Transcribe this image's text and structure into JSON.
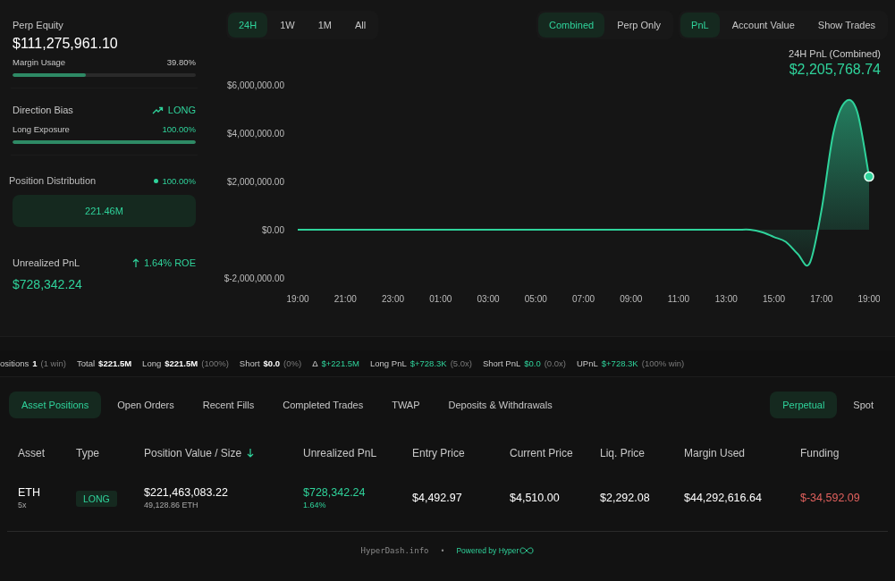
{
  "left_panel": {
    "perp_equity": {
      "label": "Perp Equity",
      "value": "$111,275,961.10"
    },
    "margin_usage": {
      "label": "Margin Usage",
      "reading": "39.80%",
      "level": 0.398
    },
    "direction_bias": {
      "label": "Direction Bias",
      "value": "LONG"
    },
    "long_exposure": {
      "label": "Long Exposure",
      "reading": "100.00%",
      "level": 1.0
    },
    "position_distribution": {
      "label": "Position Distribution",
      "reading": "100.00%",
      "bar_value": "221.46M"
    },
    "unrealized_pnl": {
      "label": "Unrealized PnL",
      "roe": "1.64% ROE",
      "value": "$728,342.24"
    }
  },
  "range_tabs": [
    {
      "label": "24H",
      "selected": true
    },
    {
      "label": "1W",
      "selected": false
    },
    {
      "label": "1M",
      "selected": false
    },
    {
      "label": "All",
      "selected": false
    }
  ],
  "mode_tabs": [
    {
      "label": "Combined",
      "selected": true
    },
    {
      "label": "Perp Only",
      "selected": false
    }
  ],
  "metric_tabs": [
    {
      "label": "PnL",
      "selected": true
    },
    {
      "label": "Account Value",
      "selected": false
    },
    {
      "label": "Show Trades",
      "selected": false
    }
  ],
  "chart_summary": {
    "label": "24H PnL (Combined)",
    "value": "$2,205,768.74"
  },
  "chart_data": {
    "type": "area",
    "categories": [
      "19:00",
      null,
      null,
      null,
      "21:00",
      null,
      null,
      null,
      "23:00",
      null,
      null,
      null,
      "01:00",
      null,
      null,
      null,
      "03:00",
      null,
      null,
      null,
      "05:00",
      null,
      null,
      null,
      "07:00",
      null,
      null,
      null,
      "09:00",
      null,
      null,
      null,
      "11:00",
      null,
      null,
      null,
      "13:00",
      null,
      null,
      null,
      "15:00",
      null,
      null,
      null,
      "17:00",
      null,
      null,
      null,
      "19:00"
    ],
    "series": [
      {
        "color": "#2fd39b",
        "values": [
          0,
          0,
          0,
          0,
          0,
          0,
          0,
          0,
          0,
          0,
          0,
          0,
          0,
          0,
          0,
          0,
          0,
          0,
          0,
          0,
          0,
          0,
          0,
          0,
          0,
          0,
          0,
          0,
          0,
          0,
          0,
          0,
          0,
          0,
          0,
          0,
          0,
          0,
          0,
          -100000,
          -300000,
          -500000,
          -1000000,
          -1400000,
          800000,
          4000000,
          5300000,
          4900000,
          2200000
        ]
      }
    ],
    "ylim": [
      -2000000,
      6000000
    ],
    "yticks": [
      {
        "value": 6000000,
        "label": "$6,000,000.00"
      },
      {
        "value": 4000000,
        "label": "$4,000,000.00"
      },
      {
        "value": 2000000,
        "label": "$2,000,000.00"
      },
      {
        "value": 0,
        "label": "$0.00"
      },
      {
        "value": -2000000,
        "label": "$-2,000,000.00"
      }
    ]
  },
  "stats": [
    {
      "label": "ositions",
      "value": "1",
      "note": "(1 win)",
      "kind": "plain"
    },
    {
      "label": "Total",
      "value": "$221.5M",
      "kind": "plain"
    },
    {
      "label": "Long",
      "value": "$221.5M",
      "note": "(100%)",
      "kind": "plain"
    },
    {
      "label": "Short",
      "value": "$0.0",
      "note": "(0%)",
      "kind": "plain"
    },
    {
      "label": "Δ",
      "value": "$+221.5M",
      "kind": "gain"
    },
    {
      "label": "Long PnL",
      "value": "$+728.3K",
      "note": "(5.0x)",
      "kind": "gain"
    },
    {
      "label": "Short PnL",
      "value": "$0.0",
      "note": "(0.0x)",
      "kind": "gain"
    },
    {
      "label": "UPnL",
      "value": "$+728.3K",
      "note": "(100% win)",
      "kind": "gain"
    }
  ],
  "section_tabs": [
    {
      "label": "Asset Positions",
      "selected": true
    },
    {
      "label": "Open Orders",
      "selected": false
    },
    {
      "label": "Recent Fills",
      "selected": false
    },
    {
      "label": "Completed Trades",
      "selected": false
    },
    {
      "label": "TWAP",
      "selected": false
    },
    {
      "label": "Deposits & Withdrawals",
      "selected": false
    }
  ],
  "market_tabs": [
    {
      "label": "Perpetual",
      "selected": true
    },
    {
      "label": "Spot",
      "selected": false
    }
  ],
  "table": {
    "columns": [
      {
        "label": "Asset",
        "sorted": false
      },
      {
        "label": "Type",
        "sorted": false
      },
      {
        "label": "Position Value / Size",
        "sorted": true
      },
      {
        "label": "Unrealized PnL",
        "sorted": false
      },
      {
        "label": "Entry Price",
        "sorted": false
      },
      {
        "label": "Current Price",
        "sorted": false
      },
      {
        "label": "Liq. Price",
        "sorted": false
      },
      {
        "label": "Margin Used",
        "sorted": false
      },
      {
        "label": "Funding",
        "sorted": false
      }
    ],
    "rows": [
      {
        "asset": "ETH",
        "leverage": "5x",
        "type": "LONG",
        "position_value": "$221,463,083.22",
        "size": "49,128.86 ETH",
        "pnl": "$728,342.24",
        "pnl_pct": "1.64%",
        "entry_price": "$4,492.97",
        "current_price": "$4,510.00",
        "liq_price": "$2,292.08",
        "margin_used": "$44,292,616.64",
        "funding": "$-34,592.09"
      }
    ]
  },
  "footer": {
    "site": "HyperDash.info",
    "separator": "•",
    "powered": "Powered by Hyper"
  }
}
